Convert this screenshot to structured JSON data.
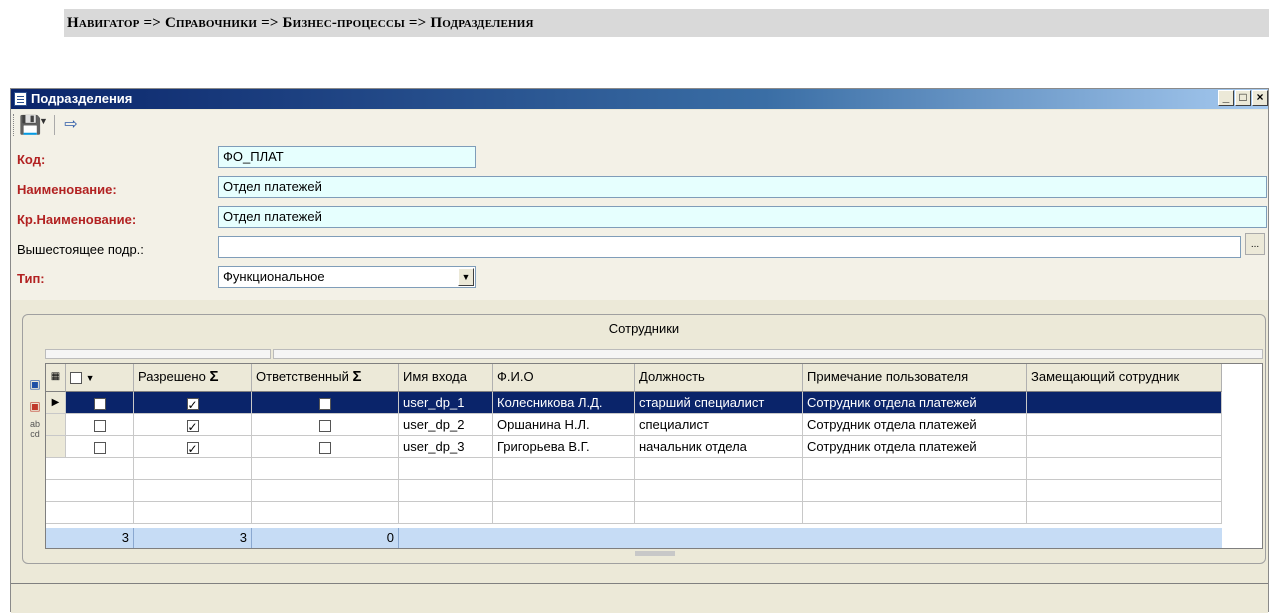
{
  "breadcrumb": "Навигатор => Справочники => Бизнес-процессы => Подразделения",
  "window": {
    "title": "Подразделения",
    "min": "_",
    "max": "□",
    "close": "×"
  },
  "toolbar": {
    "save_icon": "floppy-disk-icon",
    "exit_icon": "exit-icon"
  },
  "form": {
    "code_label": "Код:",
    "code_value": "ФО_ПЛАТ",
    "name_label": "Наименование:",
    "name_value": "Отдел платежей",
    "short_label": "Кр.Наименование:",
    "short_value": "Отдел платежей",
    "parent_label": "Вышестоящее подр.:",
    "parent_value": "",
    "parent_btn": "...",
    "type_label": "Тип:",
    "type_value": "Функциональное"
  },
  "panel": {
    "title": "Сотрудники"
  },
  "grid": {
    "columns": [
      "Разрешено",
      "Ответственный",
      "Имя входа",
      "Ф.И.О",
      "Должность",
      "Примечание пользователя",
      "Замещающий сотрудник"
    ],
    "sigma": "Σ",
    "rows": [
      {
        "selected": false,
        "allowed": true,
        "responsible": false,
        "login": "user_dp_1",
        "fio": "Колесникова Л.Д.",
        "position": "старший специалист",
        "note": "Сотрудник отдела платежей",
        "substitute": ""
      },
      {
        "selected": false,
        "allowed": true,
        "responsible": false,
        "login": "user_dp_2",
        "fio": "Оршанина Н.Л.",
        "position": "специалист",
        "note": "Сотрудник отдела платежей",
        "substitute": ""
      },
      {
        "selected": false,
        "allowed": true,
        "responsible": false,
        "login": "user_dp_3",
        "fio": "Григорьева В.Г.",
        "position": "начальник отдела",
        "note": "Сотрудник отдела платежей",
        "substitute": ""
      }
    ],
    "footer": {
      "count": "3",
      "allowed": "3",
      "responsible": "0"
    }
  }
}
